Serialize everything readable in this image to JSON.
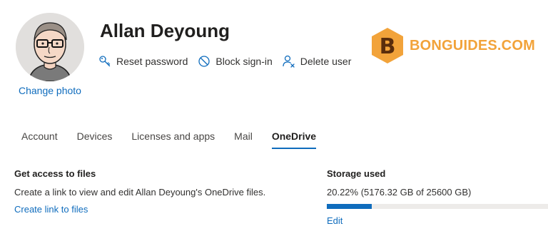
{
  "user": {
    "name": "Allan Deyoung",
    "change_photo_label": "Change photo"
  },
  "actions": [
    {
      "label": "Reset password",
      "icon": "key-icon"
    },
    {
      "label": "Block sign-in",
      "icon": "block-icon"
    },
    {
      "label": "Delete user",
      "icon": "delete-user-icon"
    }
  ],
  "watermark": {
    "text": "BONGUIDES.COM",
    "color": "#f2a33a"
  },
  "tabs": [
    {
      "label": "Account",
      "active": false
    },
    {
      "label": "Devices",
      "active": false
    },
    {
      "label": "Licenses and apps",
      "active": false
    },
    {
      "label": "Mail",
      "active": false
    },
    {
      "label": "OneDrive",
      "active": true
    }
  ],
  "files": {
    "title": "Get access to files",
    "description": "Create a link to view and edit Allan Deyoung's OneDrive files.",
    "link": "Create link to files"
  },
  "storage": {
    "title": "Storage used",
    "summary": "20.22% (5176.32 GB of 25600 GB)",
    "percent": 20.22,
    "edit_label": "Edit"
  },
  "colors": {
    "accent": "#0f6cbd",
    "bar_track": "#edebe9"
  }
}
